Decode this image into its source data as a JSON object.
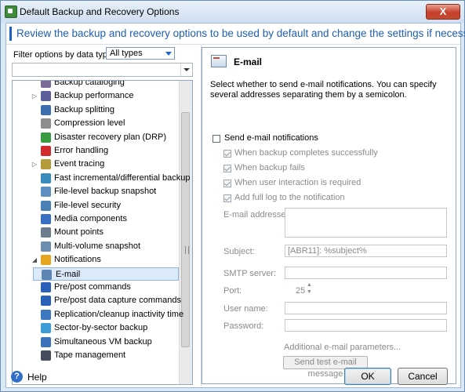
{
  "window": {
    "title": "Default Backup and Recovery Options",
    "close_glyph": "X"
  },
  "header": {
    "text": "Review the backup and recovery options to be used by default and change the settings if necessary"
  },
  "filter": {
    "label": "Filter options by data type:",
    "selected": "All types"
  },
  "tree": {
    "items": [
      {
        "label": "Backup cataloging",
        "icon": "catalog-icon",
        "color": "#7a6a9a"
      },
      {
        "label": "Backup performance",
        "icon": "performance-icon",
        "color": "#5b5f9b",
        "expander": "▷"
      },
      {
        "label": "Backup splitting",
        "icon": "splitting-icon",
        "color": "#3d6fb0"
      },
      {
        "label": "Compression level",
        "icon": "compression-icon",
        "color": "#8d8d8d"
      },
      {
        "label": "Disaster recovery plan (DRP)",
        "icon": "drp-icon",
        "color": "#3a9b43"
      },
      {
        "label": "Error handling",
        "icon": "error-icon",
        "color": "#d12b2b"
      },
      {
        "label": "Event tracing",
        "icon": "event-icon",
        "color": "#b69b3a",
        "expander": "▷"
      },
      {
        "label": "Fast incremental/differential backup",
        "icon": "incremental-icon",
        "color": "#3a8bbd"
      },
      {
        "label": "File-level backup snapshot",
        "icon": "snapshot-icon",
        "color": "#5d8fc3"
      },
      {
        "label": "File-level security",
        "icon": "security-icon",
        "color": "#4a7fb5"
      },
      {
        "label": "Media components",
        "icon": "media-icon",
        "color": "#3a70c4"
      },
      {
        "label": "Mount points",
        "icon": "mount-icon",
        "color": "#6c7c8c"
      },
      {
        "label": "Multi-volume snapshot",
        "icon": "multivolume-icon",
        "color": "#6d8db0"
      },
      {
        "label": "Notifications",
        "icon": "notifications-icon",
        "color": "#e6a520",
        "expander": "◢"
      },
      {
        "label": "E-mail",
        "icon": "email-icon",
        "color": "#5d86b5",
        "selected": true,
        "child": true
      },
      {
        "label": "Pre/post commands",
        "icon": "prepost-icon",
        "color": "#2a60b8"
      },
      {
        "label": "Pre/post data capture commands",
        "icon": "capture-icon",
        "color": "#2a60b8"
      },
      {
        "label": "Replication/cleanup inactivity time",
        "icon": "replication-icon",
        "color": "#3c78c0"
      },
      {
        "label": "Sector-by-sector backup",
        "icon": "sector-icon",
        "color": "#3d9bd8"
      },
      {
        "label": "Simultaneous VM backup",
        "icon": "vm-icon",
        "color": "#3d73ba"
      },
      {
        "label": "Tape management",
        "icon": "tape-icon",
        "color": "#454c5c"
      }
    ]
  },
  "email": {
    "title": "E-mail",
    "description": "Select whether to send e-mail notifications. You can specify several addresses separating them by a semicolon.",
    "send_label": "Send e-mail notifications",
    "options": [
      {
        "label": "When backup completes successfully",
        "checked": true
      },
      {
        "label": "When backup fails",
        "checked": true
      },
      {
        "label": "When user interaction is required",
        "checked": true
      },
      {
        "label": "Add full log to the notification",
        "checked": true
      }
    ],
    "addresses_label": "E-mail addresses:",
    "addresses_value": "",
    "subject_label": "Subject:",
    "subject_value": "[ABR11]: %subject%",
    "smtp_label": "SMTP server:",
    "smtp_value": "",
    "port_label": "Port:",
    "port_value": "25",
    "username_label": "User name:",
    "username_value": "",
    "password_label": "Password:",
    "password_value": "",
    "additional_link": "Additional e-mail parameters...",
    "test_button": "Send test e-mail message"
  },
  "footer": {
    "help_label": "Help",
    "ok_label": "OK",
    "cancel_label": "Cancel"
  }
}
